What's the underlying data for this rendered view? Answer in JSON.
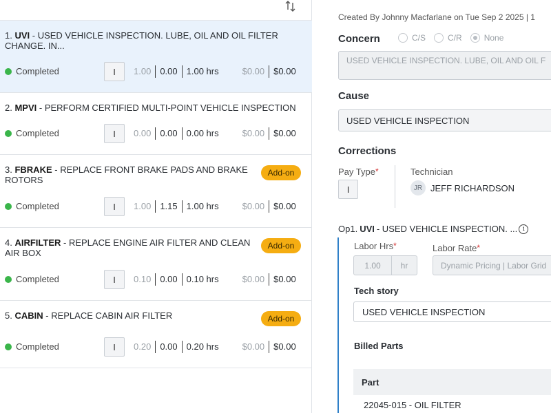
{
  "jobs": [
    {
      "index": "1.",
      "code": "UVI",
      "description": " - USED VEHICLE INSPECTION. LUBE, OIL AND OIL FILTER CHANGE. IN...",
      "status": "Completed",
      "pay_type": "I",
      "sold_hrs": "1.00",
      "actual_hrs": "0.00",
      "billed_hrs": "1.00 hrs",
      "parts_cost": "$0.00",
      "total": "$0.00",
      "addon": ""
    },
    {
      "index": "2.",
      "code": "MPVI",
      "description": " - PERFORM CERTIFIED MULTI-POINT VEHICLE INSPECTION",
      "status": "Completed",
      "pay_type": "I",
      "sold_hrs": "0.00",
      "actual_hrs": "0.00",
      "billed_hrs": "0.00 hrs",
      "parts_cost": "$0.00",
      "total": "$0.00",
      "addon": ""
    },
    {
      "index": "3.",
      "code": "FBRAKE",
      "description": " - REPLACE FRONT BRAKE PADS AND BRAKE ROTORS",
      "status": "Completed",
      "pay_type": "I",
      "sold_hrs": "1.00",
      "actual_hrs": "1.15",
      "billed_hrs": "1.00 hrs",
      "parts_cost": "$0.00",
      "total": "$0.00",
      "addon": "Add-on"
    },
    {
      "index": "4.",
      "code": "AIRFILTER",
      "description": " - REPLACE ENGINE AIR FILTER AND CLEAN AIR BOX",
      "status": "Completed",
      "pay_type": "I",
      "sold_hrs": "0.10",
      "actual_hrs": "0.00",
      "billed_hrs": "0.10 hrs",
      "parts_cost": "$0.00",
      "total": "$0.00",
      "addon": "Add-on"
    },
    {
      "index": "5.",
      "code": "CABIN",
      "description": " - REPLACE CABIN AIR FILTER",
      "status": "Completed",
      "pay_type": "I",
      "sold_hrs": "0.20",
      "actual_hrs": "0.00",
      "billed_hrs": "0.20 hrs",
      "parts_cost": "$0.00",
      "total": "$0.00",
      "addon": "Add-on"
    }
  ],
  "detail": {
    "created": "Created By Johnny Macfarlane on Tue Sep 2 2025 | 1",
    "concern_label": "Concern",
    "concern_options": [
      "C/S",
      "C/R",
      "None"
    ],
    "concern_selected": "None",
    "concern_text": "USED VEHICLE INSPECTION. LUBE, OIL AND OIL F",
    "cause_label": "Cause",
    "cause_value": "USED VEHICLE INSPECTION",
    "corrections_label": "Corrections",
    "pay_type_label": "Pay Type",
    "pay_type_value": "I",
    "technician_label": "Technician",
    "technician_initials": "JR",
    "technician_name": "JEFF RICHARDSON",
    "op_prefix": "Op1.",
    "op_code": "UVI",
    "op_desc": "- USED VEHICLE INSPECTION. ...",
    "labor_hrs_label": "Labor Hrs",
    "labor_hrs_value": "1.00",
    "labor_hrs_unit": "hr",
    "labor_rate_label": "Labor Rate",
    "labor_rate_value": "Dynamic Pricing | Labor Grid",
    "tech_story_label": "Tech story",
    "tech_story_value": "USED VEHICLE INSPECTION",
    "billed_parts_label": "Billed Parts",
    "parts_header": "Part",
    "parts": [
      "22045-015 - OIL FILTER"
    ]
  },
  "colors": {
    "completed": "#3ab54a",
    "addon": "#f5ad12",
    "selected_row": "#e9f2fc",
    "op_accent": "#2f80c8"
  },
  "icons": {
    "sort": "sort-arrows-icon",
    "info": "info-icon"
  }
}
